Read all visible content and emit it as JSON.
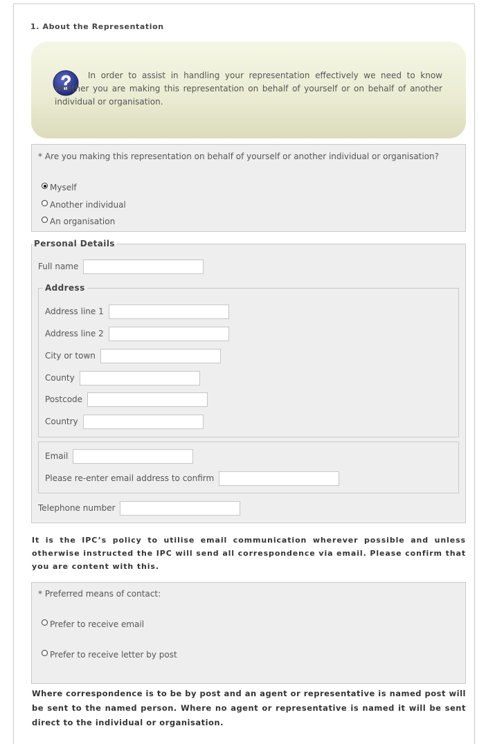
{
  "section": {
    "title": "1. About the Representation"
  },
  "info": {
    "text": "In order to assist in handling your representation effectively we need to know whether you are making this representation on behalf of yourself or on behalf of another individual or organisation.",
    "icon": "question-mark-icon",
    "icon_color": "#2e3a8c"
  },
  "behalf": {
    "question": "* Are you making this representation on behalf of yourself or another individual or organisation?",
    "options": [
      "Myself",
      "Another individual",
      "An organisation"
    ],
    "selected": "Myself"
  },
  "personal": {
    "legend": "Personal Details",
    "full_name_label": "Full name",
    "address": {
      "legend": "Address",
      "line1_label": "Address line 1",
      "line2_label": "Address line 2",
      "city_label": "City or town",
      "county_label": "County",
      "postcode_label": "Postcode",
      "country_label": "Country"
    },
    "email_label": "Email",
    "email_confirm_label": "Please re-enter email address to confirm",
    "telephone_label": "Telephone number"
  },
  "policy_notice": "It is the IPC’s policy to utilise email communication wherever possible and unless otherwise instructed the IPC will send all correspondence via email. Please confirm that you are content with this.",
  "contact": {
    "question": "* Preferred means of contact:",
    "options": [
      "Prefer to receive email",
      "Prefer to receive letter by post"
    ]
  },
  "post_notice": "Where correspondence is to be by post and an agent or representative is named post will be sent to the named person. Where no agent or representative is named it will be sent direct to the individual or organisation."
}
